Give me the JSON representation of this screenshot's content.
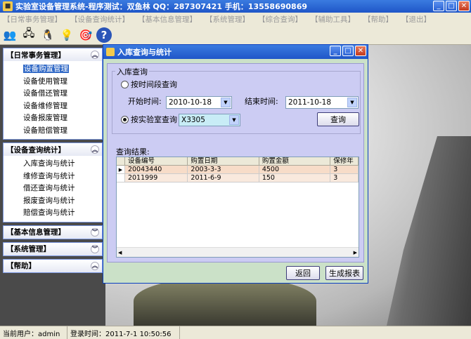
{
  "window": {
    "title": "实验室设备管理系统-程序测试：双鱼林 QQ：287307421 手机：13558690869",
    "minimize": "_",
    "maximize": "□",
    "close": "✕"
  },
  "menubar": [
    "【日常事务管理】",
    "【设备查询统计】",
    "【基本信息管理】",
    "【系统管理】",
    "【综合查询】",
    "【辅助工具】",
    "【帮助】",
    "【退出】"
  ],
  "toolbar": [
    {
      "icon": "users-icon",
      "glyph": "👥"
    },
    {
      "icon": "network-icon",
      "glyph": "🖧"
    },
    {
      "icon": "qq-icon",
      "glyph": "🐧"
    },
    {
      "icon": "lightbulb-icon",
      "glyph": "💡"
    },
    {
      "icon": "target-icon",
      "glyph": "🎯"
    },
    {
      "icon": "help-icon",
      "glyph": "?"
    }
  ],
  "sidebar": {
    "panels": [
      {
        "title": "【日常事务管理】",
        "chev": "︽",
        "items": [
          "设备购置管理",
          "设备使用管理",
          "设备借还管理",
          "设备维修管理",
          "设备报废管理",
          "设备赔偿管理"
        ],
        "selected": 0
      },
      {
        "title": "【设备查询统计】",
        "chev": "︽",
        "items": [
          "入库查询与统计",
          "维修查询与统计",
          "借还查询与统计",
          "报废查询与统计",
          "赔偿查询与统计"
        ]
      },
      {
        "title": "【基本信息管理】",
        "chev": "︾",
        "items": []
      },
      {
        "title": "【系统管理】",
        "chev": "︾",
        "items": []
      },
      {
        "title": "【帮助】",
        "chev": "︽",
        "items": []
      }
    ]
  },
  "dialog": {
    "title": "入库查询与统计",
    "group_label": "入库查询",
    "radio_by_date": "按时间段查询",
    "start_label": "开始时间:",
    "start_value": "2010-10-18",
    "end_label": "结束时间:",
    "end_value": "2011-10-18",
    "radio_by_lab": "按实验室查询",
    "lab_value": "X3305",
    "query_button": "查询",
    "results_label": "查询结果:",
    "back_button": "返回",
    "report_button": "生成报表",
    "arrow_down": "▼",
    "row_pointer": "▶",
    "scroll_left": "◀",
    "scroll_right": "▶"
  },
  "results": {
    "columns": [
      "设备编号",
      "购置日期",
      "购置金额",
      "保修年限"
    ],
    "rows": [
      [
        "20043440",
        "2003-3-3",
        "4500",
        "3"
      ],
      [
        "2011999",
        "2011-6-9",
        "150",
        "3"
      ]
    ]
  },
  "statusbar": {
    "user": "当前用户：admin",
    "login_time": "登录时间：2011-7-1 10:50:56"
  },
  "colors": {
    "titlebar": "#1f56c8",
    "dialog_bg": "#cbe1c8",
    "form_bg": "#ccccf3",
    "row_highlight": "#f7dcc8"
  }
}
